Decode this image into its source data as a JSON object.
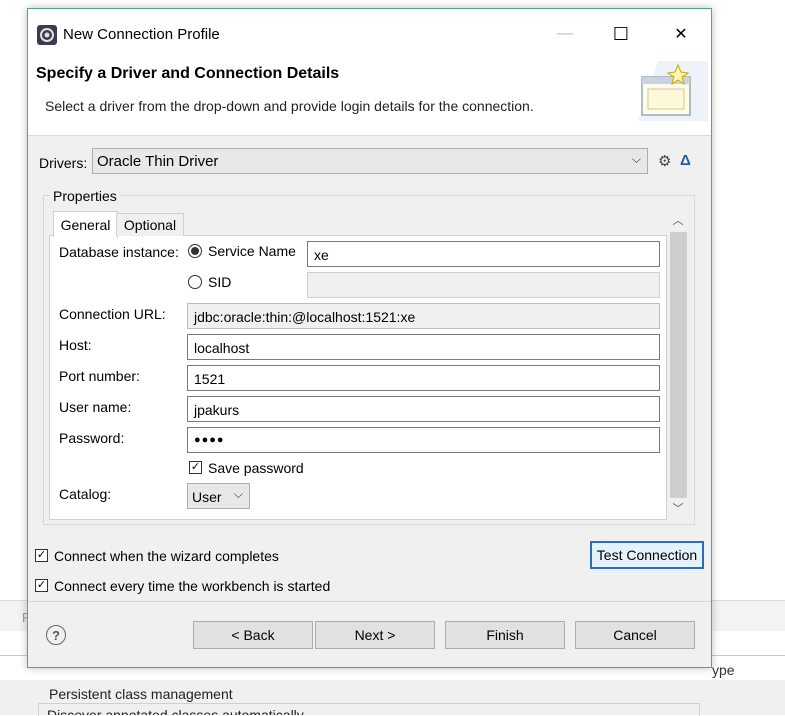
{
  "background": {
    "strip_text": "P",
    "type_label": "ype",
    "persistent_label": "Persistent class management",
    "cut_text": "Discover annotated classes automatically"
  },
  "dialog": {
    "title": "New Connection Profile",
    "minimize_glyph": "—",
    "maximize_glyph": "☐",
    "close_glyph": "✕"
  },
  "header": {
    "title": "Specify a Driver and Connection Details",
    "description": "Select a driver from the drop-down and provide login details for the connection."
  },
  "drivers": {
    "label": "Drivers:",
    "selected": "Oracle Thin Driver",
    "arrow": "⌵",
    "new_icon_glyph": "⚙",
    "edit_icon_glyph": "Δ"
  },
  "properties": {
    "group_title": "Properties",
    "tabs": [
      {
        "label": "General",
        "active": true
      },
      {
        "label": "Optional",
        "active": false
      }
    ],
    "db_instance_label": "Database instance:",
    "service_name_label": "Service Name",
    "service_name_value": "xe",
    "service_name_selected": true,
    "sid_label": "SID",
    "sid_value": "",
    "url_label": "Connection URL:",
    "url_value": "jdbc:oracle:thin:@localhost:1521:xe",
    "host_label": "Host:",
    "host_value": "localhost",
    "port_label": "Port number:",
    "port_value": "1521",
    "user_label": "User name:",
    "user_value": "jpakurs",
    "password_label": "Password:",
    "password_value": "●●●●",
    "save_password_label": "Save password",
    "save_password_checked": true,
    "catalog_label": "Catalog:",
    "catalog_value": "User",
    "catalog_arrow": "⌵",
    "scroll_up": "︿",
    "scroll_down": "﹀"
  },
  "options": {
    "connect_wizard_label": "Connect when the wizard completes",
    "connect_wizard_checked": true,
    "connect_startup_label": "Connect every time the workbench is started",
    "connect_startup_checked": true,
    "test_connection_label": "Test Connection",
    "checkmark": "✓"
  },
  "footer": {
    "help_glyph": "?",
    "back_label": "< Back",
    "next_label": "Next >",
    "finish_label": "Finish",
    "cancel_label": "Cancel"
  }
}
